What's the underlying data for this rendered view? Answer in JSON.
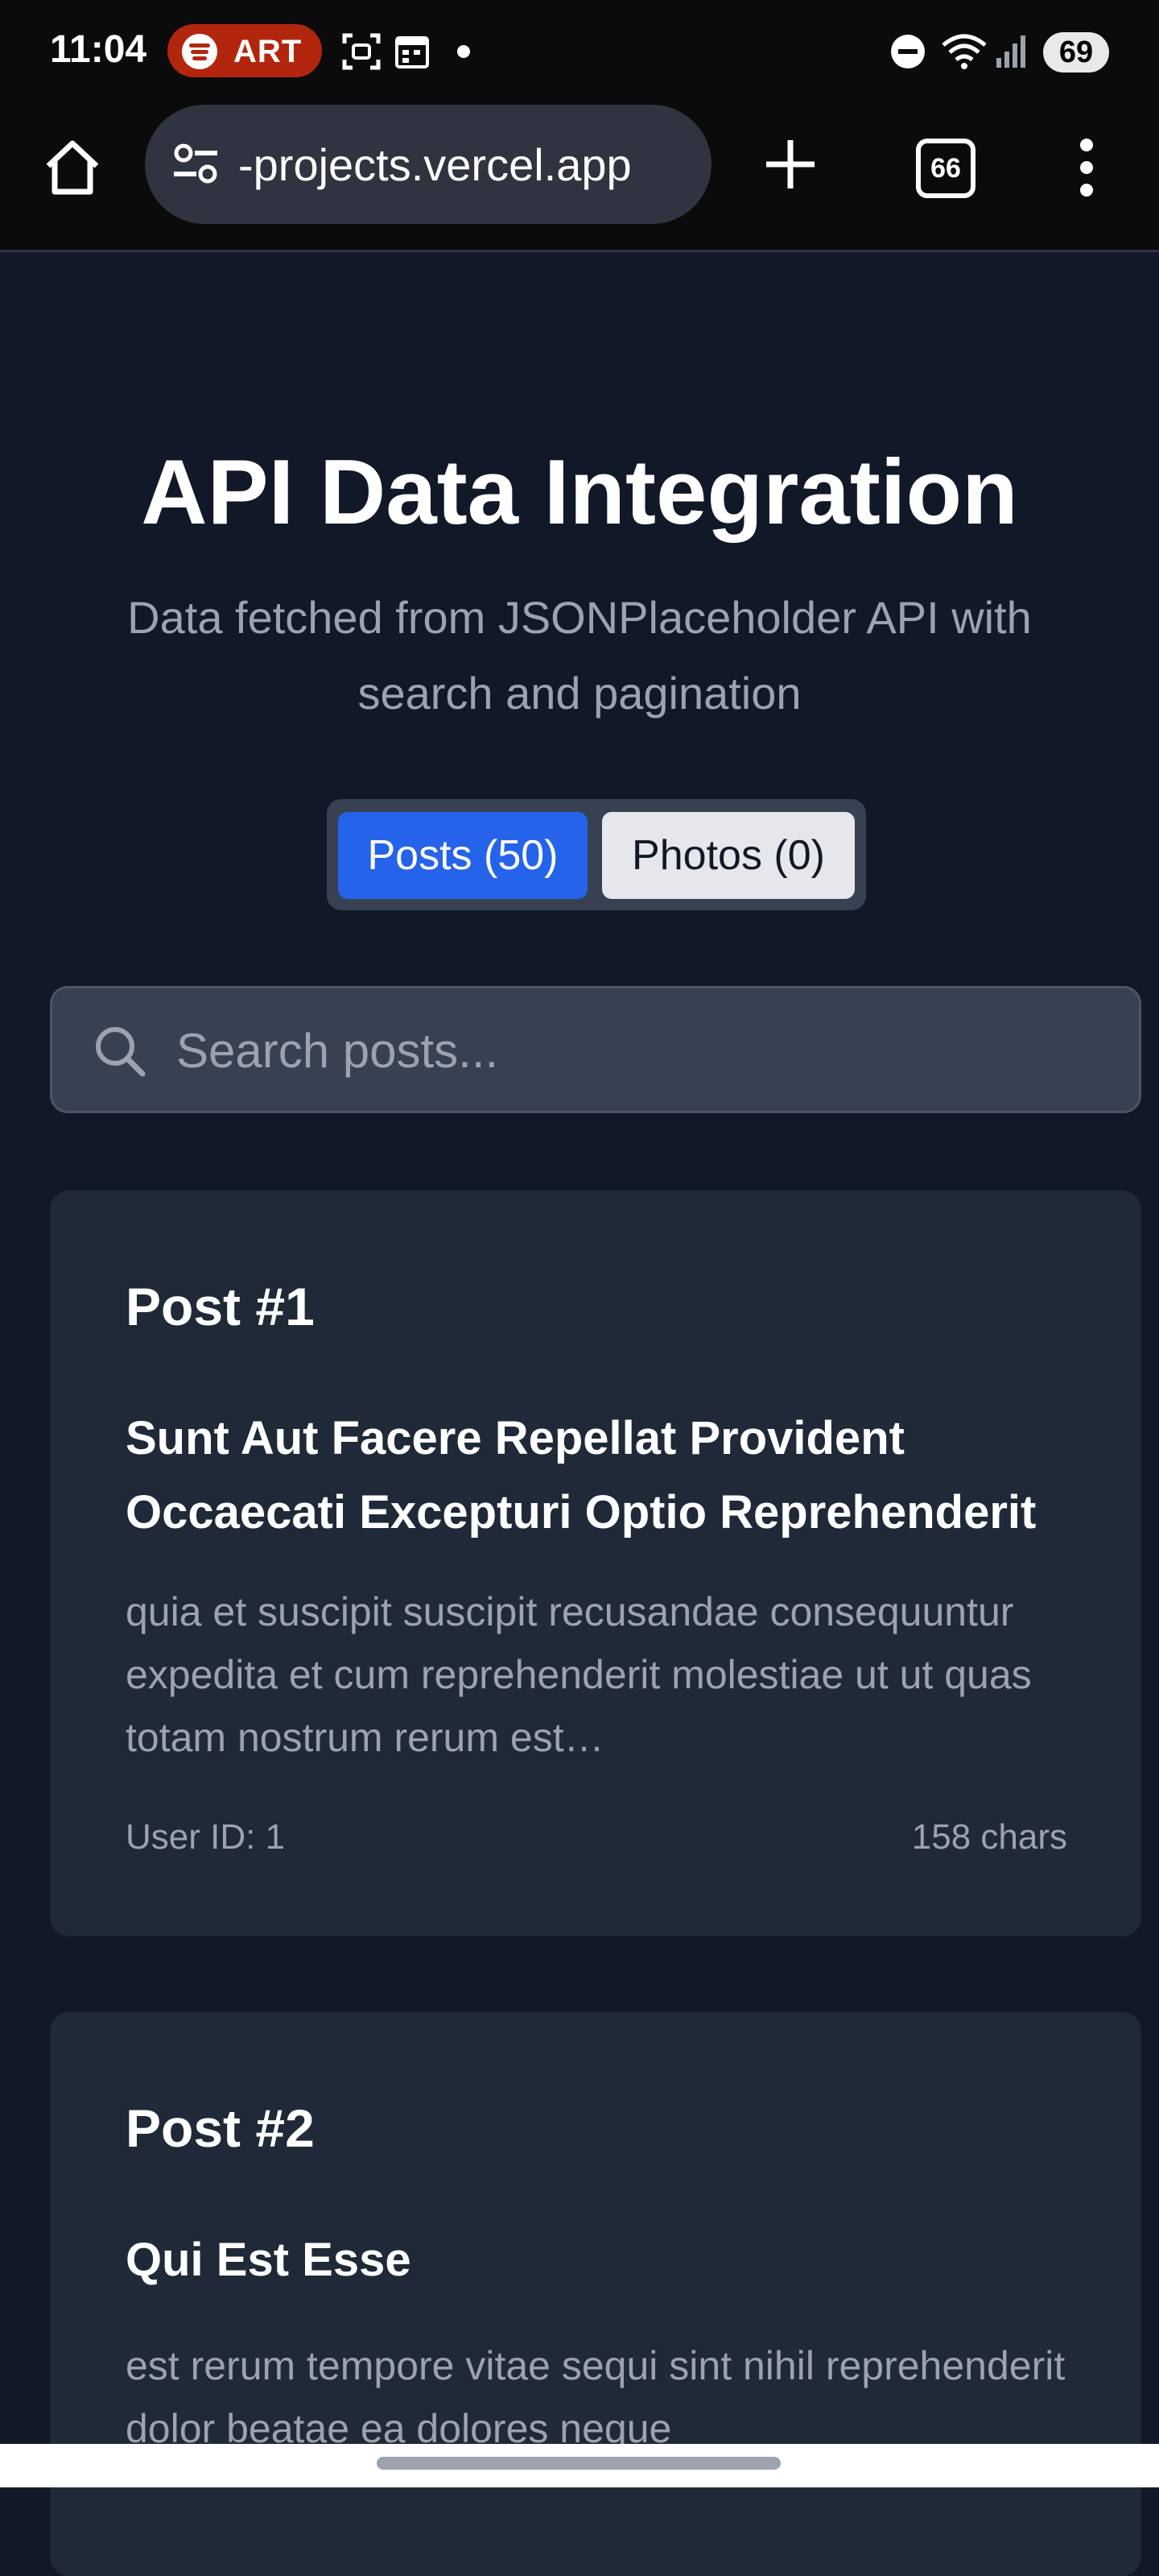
{
  "status_bar": {
    "time": "11:04",
    "music_badge": "ART",
    "battery": "69",
    "icons": [
      "spotify-icon",
      "screenshot-icon",
      "calendar-icon",
      "notification-dot-icon",
      "dnd-icon",
      "wifi-icon",
      "signal-icon"
    ]
  },
  "browser": {
    "url": "-projects.vercel.app",
    "tab_count": "66",
    "icons": [
      "home-icon",
      "site-settings-icon",
      "new-tab-icon",
      "tab-switcher-icon",
      "more-menu-icon"
    ]
  },
  "page": {
    "title": "API Data Integration",
    "subtitle": "Data fetched from JSONPlaceholder API with search and pagination"
  },
  "tabs": {
    "posts": "Posts (50)",
    "photos": "Photos (0)"
  },
  "search": {
    "placeholder": "Search posts..."
  },
  "posts": [
    {
      "heading": "Post #1",
      "title": "Sunt Aut Facere Repellat Provident Occaecati Excepturi Optio Reprehenderit",
      "body": "quia et suscipit suscipit recusandae consequuntur expedita et cum reprehenderit molestiae ut ut quas totam nostrum rerum est…",
      "user": "User ID: 1",
      "chars": "158 chars"
    },
    {
      "heading": "Post #2",
      "title": "Qui Est Esse",
      "body": "est rerum tempore vitae sequi sint nihil reprehenderit dolor beatae ea dolores neque"
    }
  ],
  "colors": {
    "page_bg": "#111827",
    "card_bg": "#1f2937",
    "accent": "#2563eb",
    "muted_text": "#9ca3af",
    "music_badge": "#b3260e"
  }
}
